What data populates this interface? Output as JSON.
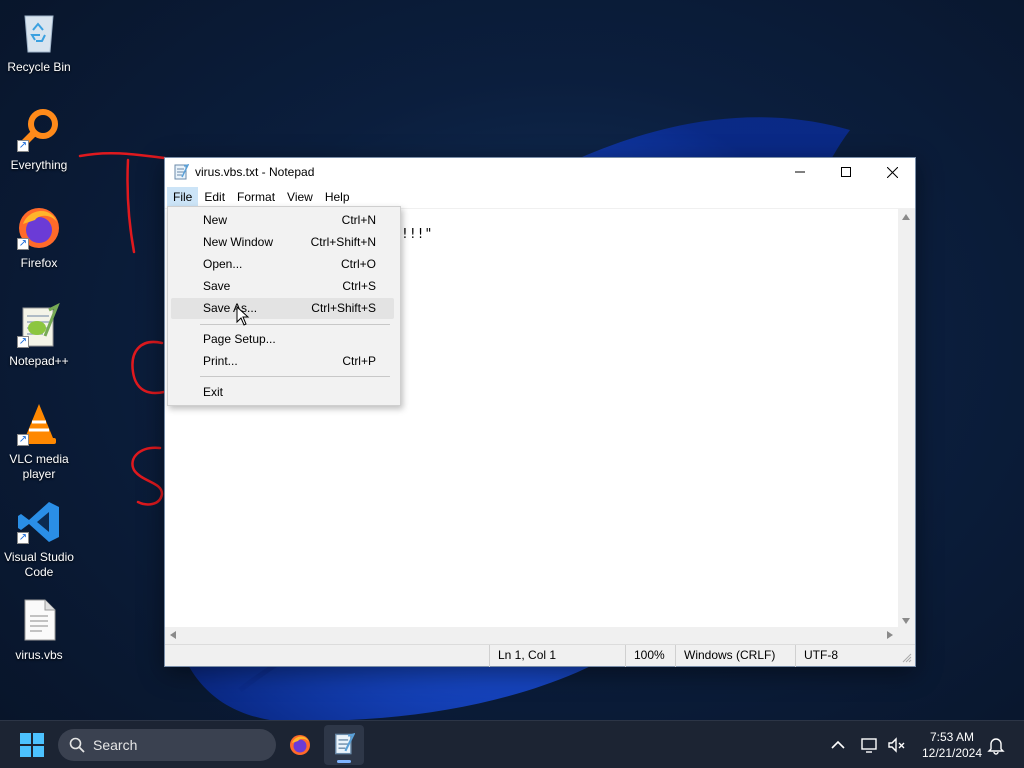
{
  "desktop": {
    "icons": [
      {
        "label": "Recycle Bin",
        "icon": "recycle-bin-icon"
      },
      {
        "label": "Everything",
        "icon": "everything-search-icon"
      },
      {
        "label": "Firefox",
        "icon": "firefox-icon"
      },
      {
        "label": "Notepad++",
        "icon": "notepadpp-icon"
      },
      {
        "label": "VLC media player",
        "icon": "vlc-icon"
      },
      {
        "label": "Visual Studio Code",
        "icon": "vscode-icon"
      },
      {
        "label": "virus.vbs",
        "icon": "vbs-file-icon"
      }
    ]
  },
  "window": {
    "title": "virus.vbs.txt - Notepad",
    "menu": [
      "File",
      "Edit",
      "Format",
      "View",
      "Help"
    ],
    "editor_visible_text": "!!!\"",
    "status": {
      "position": "Ln 1, Col 1",
      "zoom": "100%",
      "line_ending": "Windows (CRLF)",
      "encoding": "UTF-8"
    }
  },
  "file_menu": {
    "items": [
      {
        "label": "New",
        "shortcut": "Ctrl+N"
      },
      {
        "label": "New Window",
        "shortcut": "Ctrl+Shift+N"
      },
      {
        "label": "Open...",
        "shortcut": "Ctrl+O"
      },
      {
        "label": "Save",
        "shortcut": "Ctrl+S"
      },
      {
        "label": "Save As...",
        "shortcut": "Ctrl+Shift+S"
      },
      {
        "label": "Page Setup...",
        "shortcut": ""
      },
      {
        "label": "Print...",
        "shortcut": "Ctrl+P"
      },
      {
        "label": "Exit",
        "shortcut": ""
      }
    ],
    "hovered": "Save As..."
  },
  "taskbar": {
    "search_placeholder": "Search",
    "time": "7:53 AM",
    "date": "12/21/2024"
  },
  "colors": {
    "accent": "#0078d4",
    "annotation_red": "#e0191e",
    "taskbar": "#1c2433"
  }
}
